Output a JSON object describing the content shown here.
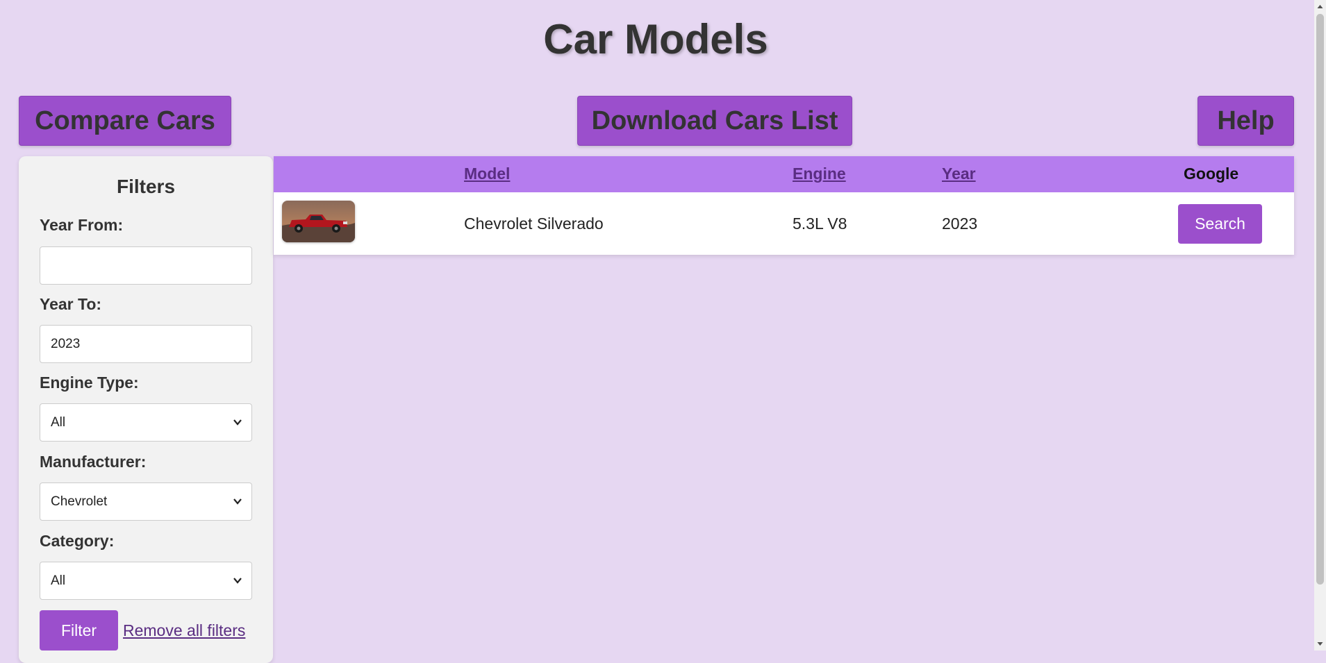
{
  "page": {
    "title": "Car Models"
  },
  "toolbar": {
    "compare_label": "Compare Cars",
    "download_label": "Download Cars List",
    "help_label": "Help"
  },
  "filters": {
    "heading": "Filters",
    "year_from": {
      "label": "Year From:",
      "value": ""
    },
    "year_to": {
      "label": "Year To:",
      "value": "2023"
    },
    "engine_type": {
      "label": "Engine Type:",
      "selected": "All"
    },
    "manufacturer": {
      "label": "Manufacturer:",
      "selected": "Chevrolet"
    },
    "category": {
      "label": "Category:",
      "selected": "All"
    },
    "filter_button": "Filter",
    "remove_link": "Remove all filters"
  },
  "table": {
    "columns": {
      "model": "Model",
      "engine": "Engine",
      "year": "Year",
      "google": "Google"
    },
    "rows": [
      {
        "model": "Chevrolet Silverado",
        "engine": "5.3L V8",
        "year": "2023",
        "action": "Search",
        "thumbnail": "red-pickup-truck-image"
      }
    ]
  },
  "colors": {
    "background": "#e6d7f2",
    "accent": "#9b4fcc",
    "table_header": "#b57cee",
    "link": "#5a2d82",
    "panel": "#f2f2f2"
  },
  "icons": [
    "chevron-down-icon",
    "scroll-up-icon",
    "scroll-down-icon"
  ]
}
